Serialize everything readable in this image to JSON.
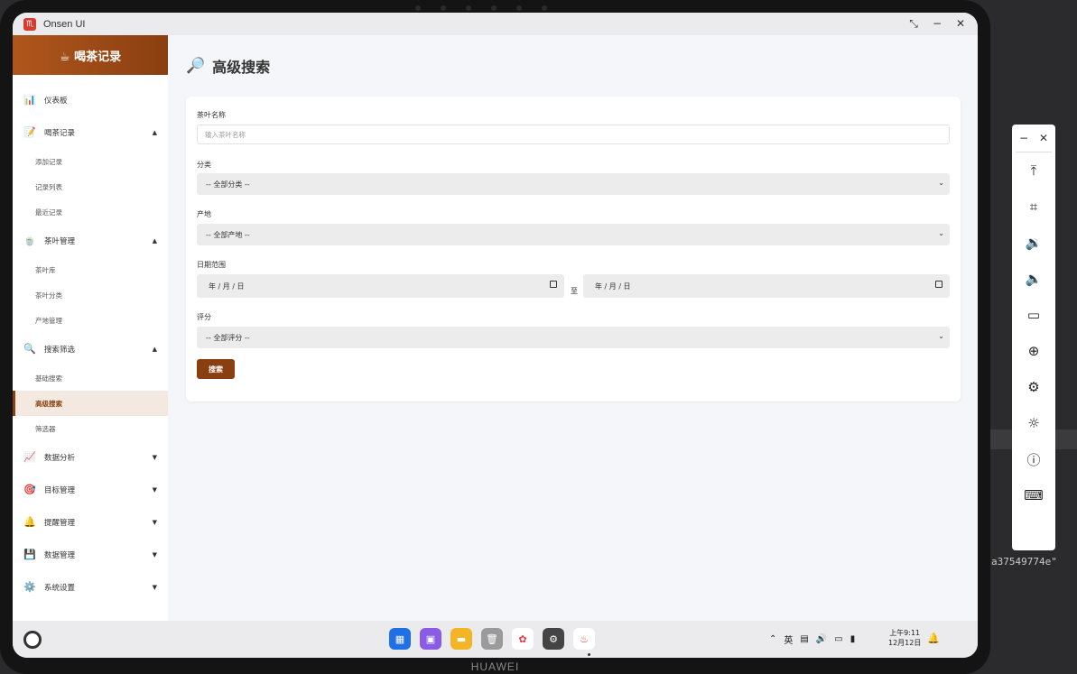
{
  "window": {
    "app_name": "Onsen UI",
    "logo_glyph": "♏"
  },
  "device": {
    "brand": "HUAWEI"
  },
  "sidebar": {
    "header": "☕ 喝茶记录",
    "items": [
      {
        "icon": "📊",
        "label": "仪表板"
      },
      {
        "icon": "📝",
        "label": "喝茶记录",
        "caret": "▲",
        "subs": [
          "添加记录",
          "记录列表",
          "最近记录"
        ]
      },
      {
        "icon": "🍵",
        "label": "茶叶管理",
        "caret": "▲",
        "subs": [
          "茶叶库",
          "茶叶分类",
          "产地管理"
        ]
      },
      {
        "icon": "🔍",
        "label": "搜索筛选",
        "caret": "▲",
        "subs": [
          "基础搜索",
          "高级搜索",
          "筛选器"
        ]
      },
      {
        "icon": "📈",
        "label": "数据分析",
        "caret": "▼"
      },
      {
        "icon": "🎯",
        "label": "目标管理",
        "caret": "▼"
      },
      {
        "icon": "🔔",
        "label": "提醒管理",
        "caret": "▼"
      },
      {
        "icon": "💾",
        "label": "数据管理",
        "caret": "▼"
      },
      {
        "icon": "⚙️",
        "label": "系统设置",
        "caret": "▼"
      }
    ]
  },
  "main": {
    "title_icon": "🔎",
    "title": "高级搜索",
    "form": {
      "tea_name_label": "茶叶名称",
      "tea_name_placeholder": "输入茶叶名称",
      "category_label": "分类",
      "category_value": "-- 全部分类 --",
      "origin_label": "产地",
      "origin_value": "-- 全部产地 --",
      "date_label": "日期范围",
      "date_from": "年 / 月 / 日",
      "date_to_sep": "至",
      "date_to": "年 / 月 / 日",
      "rating_label": "评分",
      "rating_value": "-- 全部评分 --",
      "search_button": "搜索"
    }
  },
  "taskbar": {
    "time": "上午9:11",
    "date": "12月12日",
    "tray_ime": "英"
  },
  "right_strip_text": "a37549774e\""
}
